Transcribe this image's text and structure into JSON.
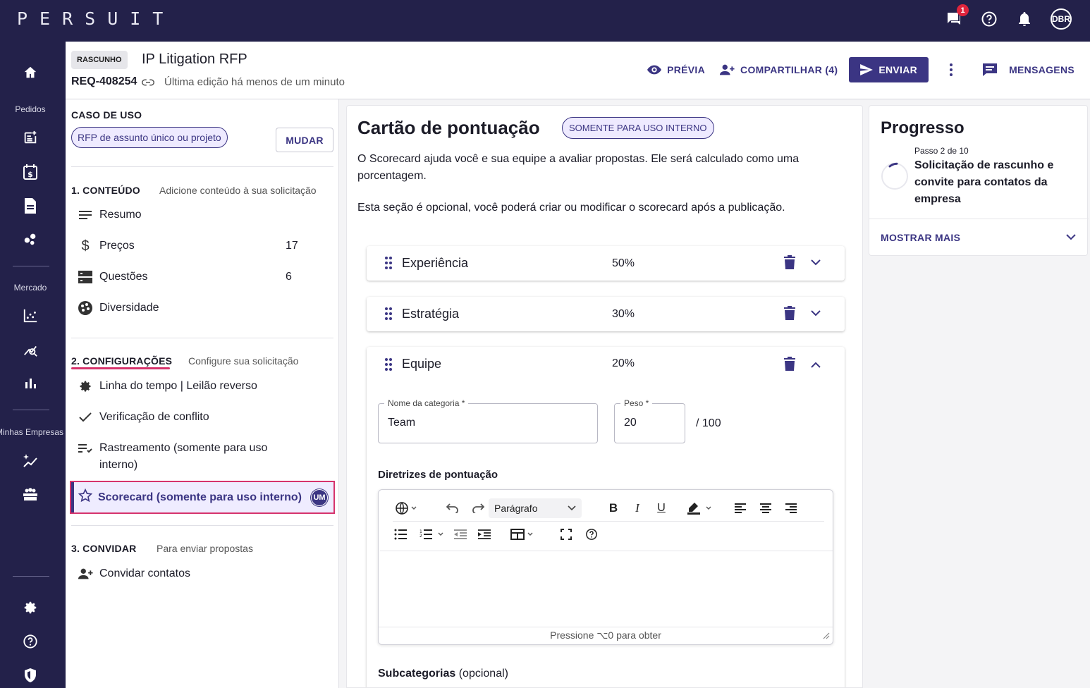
{
  "app": {
    "logo": "PERSUIT",
    "notif_count": "1",
    "avatar": "DBR"
  },
  "nav": {
    "pedidos": "Pedidos",
    "mercado": "Mercado",
    "minhas_empresas": "Minhas Empresas"
  },
  "header": {
    "status": "RASCUNHO",
    "title": "IP Litigation RFP",
    "req_id": "REQ-408254",
    "last_edit": "Última edição há menos de um minuto",
    "preview": "PRÉVIA",
    "share": "COMPARTILHAR (4)",
    "send": "ENVIAR",
    "messages": "MENSAGENS"
  },
  "sidebar": {
    "use_case_title": "CASO DE USO",
    "use_case_value": "RFP de assunto único ou projeto",
    "change": "MUDAR",
    "s1_title": "1. CONTEÚDO",
    "s1_sub": "Adicione conteúdo à sua solicitação",
    "s1_items": [
      {
        "label": "Resumo",
        "count": ""
      },
      {
        "label": "Preços",
        "count": "17"
      },
      {
        "label": "Questões",
        "count": "6"
      },
      {
        "label": "Diversidade",
        "count": ""
      }
    ],
    "s2_title": "2. CONFIGURAÇÕES",
    "s2_sub": "Configure sua solicitação",
    "s2_items": [
      {
        "label": "Linha do tempo | Leilão reverso"
      },
      {
        "label": "Verificação de conflito"
      },
      {
        "label": "Rastreamento (somente para uso interno)"
      },
      {
        "label": "Scorecard (somente para uso interno)",
        "badge": "UM"
      }
    ],
    "s3_title": "3. CONVIDAR",
    "s3_sub": "Para enviar propostas",
    "s3_items": [
      {
        "label": "Convidar contatos"
      }
    ]
  },
  "main": {
    "title": "Cartão de pontuação",
    "internal_pill": "SOMENTE PARA USO INTERNO",
    "desc": "O Scorecard ajuda você e sua equipe a avaliar propostas. Ele será calculado como uma porcentagem.",
    "optional_note": "Esta seção é opcional, você poderá criar ou modificar o scorecard após a publicação.",
    "categories": [
      {
        "name": "Experiência",
        "pct": "50%"
      },
      {
        "name": "Estratégia",
        "pct": "30%"
      },
      {
        "name": "Equipe",
        "pct": "20%"
      }
    ],
    "form": {
      "cat_name_label": "Nome da categoria  *",
      "cat_name_value": "Team",
      "weight_label": "Peso  *",
      "weight_value": "20",
      "weight_of": "/ 100",
      "guidelines": "Diretrizes de pontuação",
      "paragraph": "Parágrafo",
      "footer_hint": "Pressione ⌥0 para obter",
      "subcats": "Subcategorias",
      "subcats_opt": "(opcional)"
    }
  },
  "progress": {
    "title": "Progresso",
    "step": "Passo 2 de 10",
    "step_text": "Solicitação de rascunho e convite para contatos da empresa",
    "more": "MOSTRAR MAIS"
  },
  "colors": {
    "navy": "#23214a",
    "primary": "#3b3583",
    "accent_pink": "#d6336c",
    "badge_red": "#e0243c"
  }
}
